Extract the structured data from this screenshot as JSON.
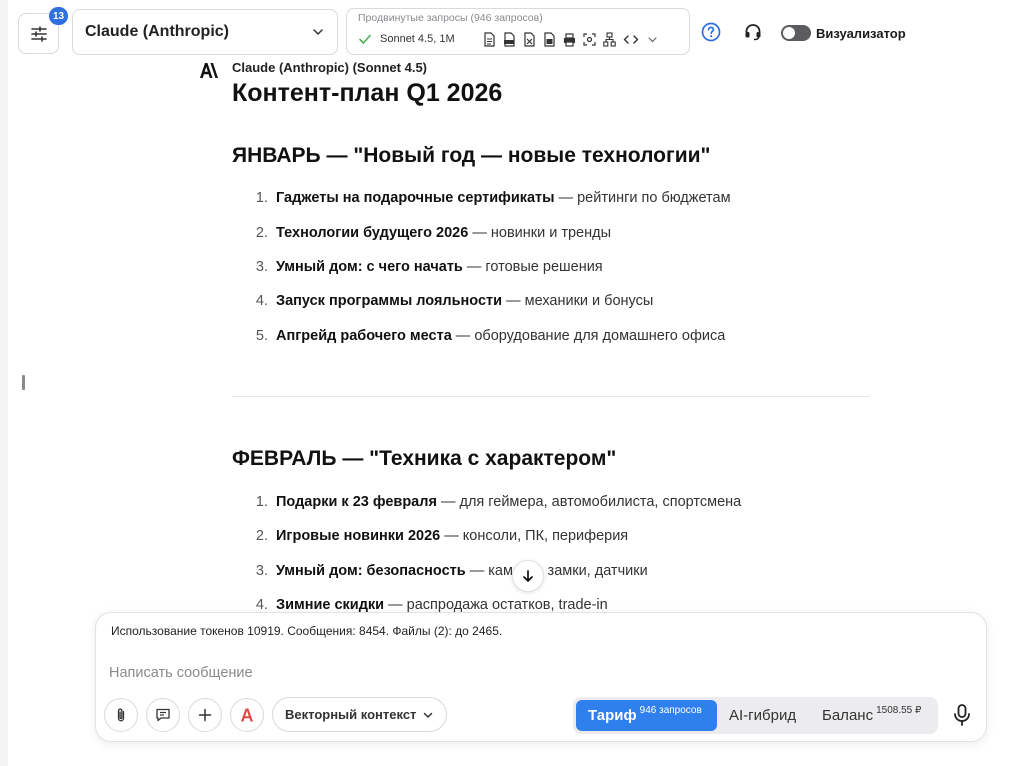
{
  "toolbar": {
    "settings_badge": "13",
    "model_select": "Claude (Anthropic)",
    "advanced_title": "Продвинутые запросы (946 запросов)",
    "model_version": "Sonnet 4.5, 1M",
    "visualizer_label": "Визуализатор",
    "visualizer_on": false,
    "icons": [
      "document-icon",
      "pdf-icon",
      "excel-icon",
      "doc-export-icon",
      "print-icon",
      "screenshot-icon",
      "diagram-icon",
      "code-icon"
    ]
  },
  "message": {
    "author": "Claude (Anthropic) (Sonnet 4.5)",
    "title": "Контент-план Q1 2026",
    "sections": [
      {
        "title": "ЯНВАРЬ — \"Новый год — новые технологии\"",
        "items": [
          {
            "num": "1.",
            "bold": "Гаджеты на подарочные сертификаты",
            "rest": " — рейтинги по бюджетам"
          },
          {
            "num": "2.",
            "bold": "Технологии будущего 2026",
            "rest": " — новинки и тренды"
          },
          {
            "num": "3.",
            "bold": "Умный дом: с чего начать",
            "rest": " — готовые решения"
          },
          {
            "num": "4.",
            "bold": "Запуск программы лояльности",
            "rest": " — механики и бонусы"
          },
          {
            "num": "5.",
            "bold": "Апгрейд рабочего места",
            "rest": " — оборудование для домашнего офиса"
          }
        ]
      },
      {
        "title": "ФЕВРАЛЬ — \"Техника с характером\"",
        "items": [
          {
            "num": "1.",
            "bold": "Подарки к 23 февраля",
            "rest": " — для геймера, автомобилиста, спортсмена"
          },
          {
            "num": "2.",
            "bold": "Игровые новинки 2026",
            "rest": " — консоли, ПК, периферия"
          },
          {
            "num": "3.",
            "bold": "Умный дом: безопасность",
            "rest": " — камеры, замки, датчики"
          },
          {
            "num": "4.",
            "bold": "Зимние скидки",
            "rest": " — распродажа остатков, trade-in"
          }
        ]
      }
    ]
  },
  "composer": {
    "usage": "Использование токенов 10919. Сообщения: 8454. Файлы (2): до 2465.",
    "placeholder": "Написать сообщение",
    "vector_context": "Векторный контекст",
    "tariff_label": "Тариф",
    "tariff_sup": "946 запросов",
    "hybrid_label": "AI-гибрид",
    "balance_label": "Баланс",
    "balance_sup": "1508.55 ₽"
  },
  "colors": {
    "accent": "#2f80ed",
    "badge": "#2f6fe0",
    "check": "#4caf50"
  }
}
